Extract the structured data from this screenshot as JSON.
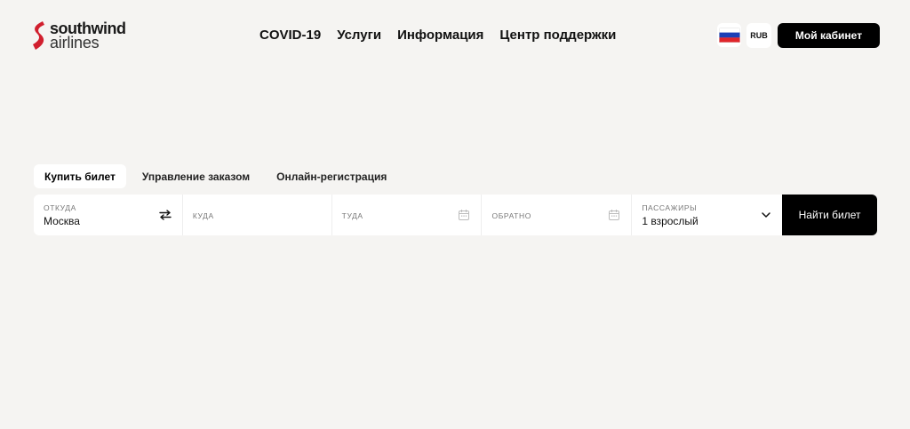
{
  "brand": {
    "name_line1": "southwind",
    "name_line2": "airlines",
    "logo_color": "#d11f2e"
  },
  "nav": {
    "items": [
      {
        "label": "COVID-19"
      },
      {
        "label": "Услуги"
      },
      {
        "label": "Информация"
      },
      {
        "label": "Центр поддержки"
      }
    ]
  },
  "header": {
    "flag_icon": "russia-flag-icon",
    "currency": "RUB",
    "cabinet_label": "Мой кабинет"
  },
  "tabs": [
    {
      "label": "Купить билет",
      "active": true
    },
    {
      "label": "Управление заказом",
      "active": false
    },
    {
      "label": "Онлайн-регистрация",
      "active": false
    }
  ],
  "search": {
    "from": {
      "label": "ОТКУДА",
      "value": "Москва"
    },
    "to": {
      "label": "КУДА"
    },
    "depart": {
      "label": "ТУДА"
    },
    "return": {
      "label": "ОБРАТНО"
    },
    "passengers": {
      "label": "ПАССАЖИРЫ",
      "value": "1 взрослый"
    },
    "submit_label": "Найти билет"
  }
}
